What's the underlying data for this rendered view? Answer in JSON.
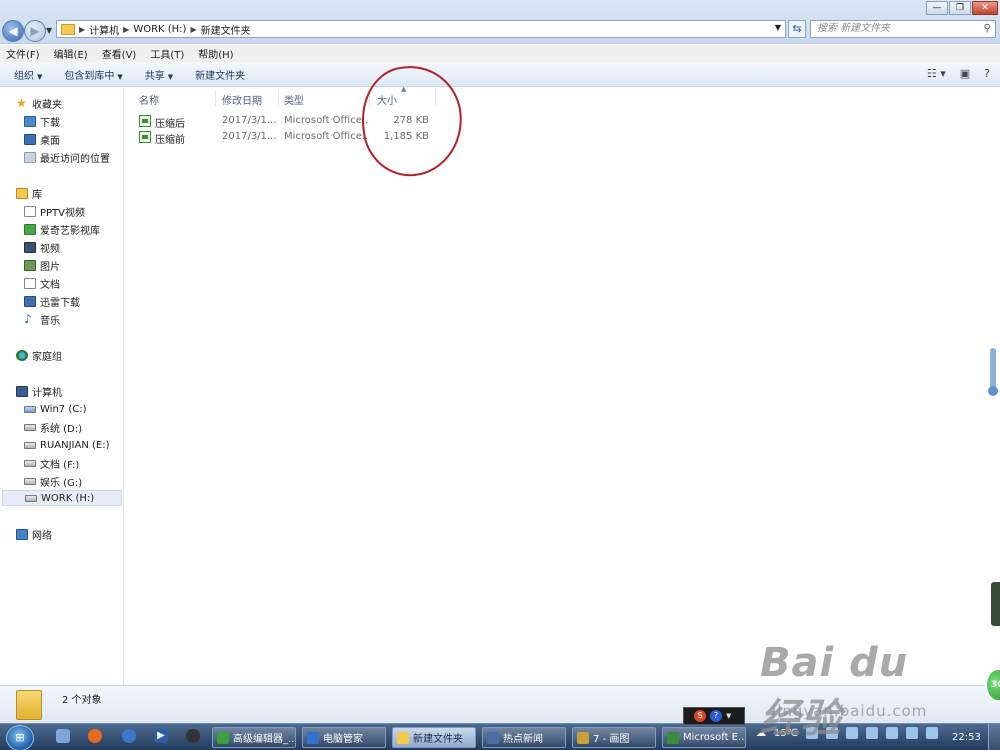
{
  "window": {
    "controls": [
      "—",
      "❐",
      "✕"
    ]
  },
  "address": {
    "segments": [
      "计算机",
      "WORK (H:)",
      "新建文件夹"
    ],
    "search_placeholder": "搜索 新建文件夹"
  },
  "menu": [
    "文件(F)",
    "编辑(E)",
    "查看(V)",
    "工具(T)",
    "帮助(H)"
  ],
  "toolbar": {
    "organize": "组织",
    "include_library": "包含到库中",
    "share": "共享",
    "new_folder": "新建文件夹"
  },
  "sidebar": {
    "favorites": {
      "label": "收藏夹",
      "items": [
        "下载",
        "桌面",
        "最近访问的位置"
      ]
    },
    "libraries": {
      "label": "库",
      "items": [
        "PPTV视频",
        "爱奇艺影视库",
        "视频",
        "图片",
        "文档",
        "迅雷下载",
        "音乐"
      ]
    },
    "homegroup": {
      "label": "家庭组"
    },
    "computer": {
      "label": "计算机",
      "items": [
        "Win7 (C:)",
        "系统 (D:)",
        "RUANJIAN (E:)",
        "文档 (F:)",
        "娱乐 (G:)",
        "WORK (H:)"
      ]
    },
    "network": {
      "label": "网络"
    }
  },
  "columns": {
    "name": "名称",
    "date": "修改日期",
    "type": "类型",
    "size": "大小"
  },
  "files": [
    {
      "name": "压缩后",
      "date": "2017/3/1...",
      "type": "Microsoft Office...",
      "size": "278 KB"
    },
    {
      "name": "压缩前",
      "date": "2017/3/1...",
      "type": "Microsoft Office...",
      "size": "1,185 KB"
    }
  ],
  "details": {
    "count": "2 个对象"
  },
  "taskbar": {
    "buttons": [
      {
        "label": "高级编辑器_...",
        "color": "#3ca13c"
      },
      {
        "label": "电脑管家",
        "color": "#2f74c8"
      },
      {
        "label": "新建文件夹",
        "color": "#f2c94c"
      },
      {
        "label": "热点新闻",
        "color": "#4b6fa5"
      },
      {
        "label": "7 - 画图",
        "color": "#c9a13a"
      },
      {
        "label": "Microsoft E...",
        "color": "#3b8b3b"
      }
    ],
    "temperature": "15℃",
    "clock": "22:53"
  },
  "overlay": {
    "watermark_main": "Bai du 经验",
    "watermark_sub": "jingyan.baidu.com",
    "badge": "30"
  },
  "colors": {
    "annotation": "#b42025",
    "accent": "#2f66b3"
  }
}
